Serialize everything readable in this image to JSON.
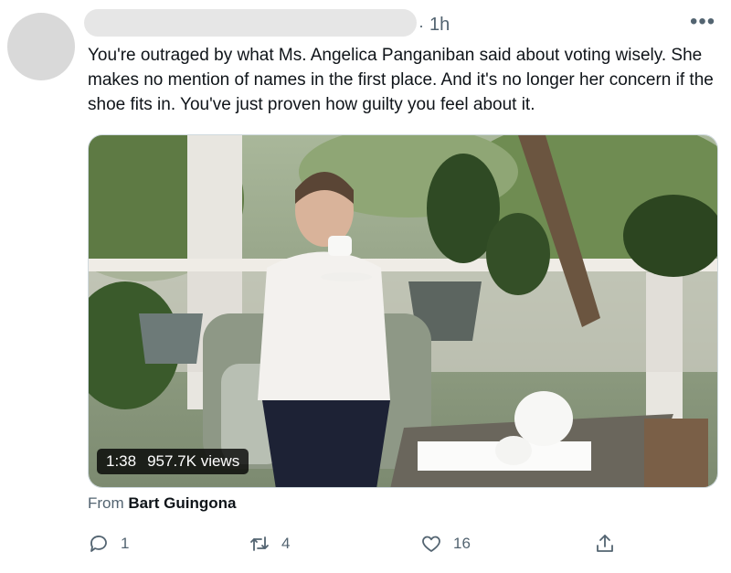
{
  "tweet": {
    "separator": "·",
    "time": "1h",
    "more_label": "•••",
    "text": "You're outraged by what Ms. Angelica Panganiban said about voting wisely. She makes no mention of names in the first place. And it's no longer her concern if the shoe fits in. You've just proven how guilty you feel about it."
  },
  "media": {
    "duration": "1:38",
    "views": "957.7K views"
  },
  "source": {
    "prefix": "From",
    "author": "Bart Guingona"
  },
  "actions": {
    "reply_icon": "reply-icon",
    "reply_count": "1",
    "retweet_icon": "retweet-icon",
    "retweet_count": "4",
    "like_icon": "heart-icon",
    "like_count": "16",
    "share_icon": "share-icon"
  },
  "colors": {
    "text": "#0f1419",
    "secondary": "#536471",
    "border": "#cfd9de"
  }
}
